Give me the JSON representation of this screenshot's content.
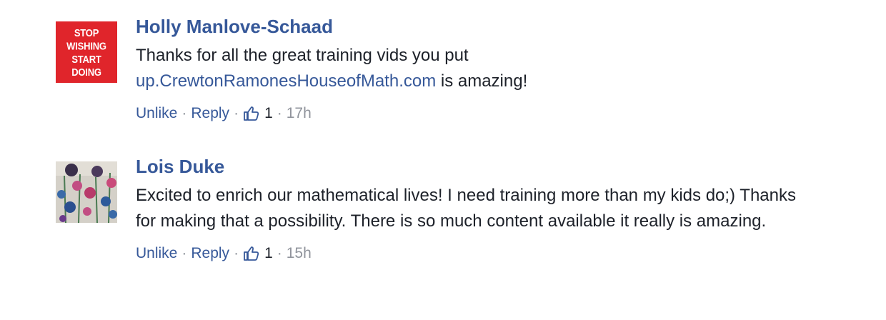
{
  "comments": [
    {
      "author": "Holly Manlove-Schaad",
      "avatar_text_line1": "STOP WISHING",
      "avatar_text_line2": "START DOING",
      "avatar_color": "#e0252b",
      "text_before": "Thanks for all the great training vids you put ",
      "link": "up.CrewtonRamonesHouseofMath.com",
      "text_after": " is amazing!",
      "unlike_label": "Unlike",
      "reply_label": "Reply",
      "like_count": "1",
      "time": "17h"
    },
    {
      "author": "Lois Duke",
      "avatar_icon": "flower-painting-image",
      "text": "Excited to enrich our mathematical lives! I need training more than my kids do;) Thanks for making that a possibility. There is so much content available it really is amazing.",
      "unlike_label": "Unlike",
      "reply_label": "Reply",
      "like_count": "1",
      "time": "15h"
    }
  ],
  "colors": {
    "link_blue": "#365899",
    "meta_gray": "#90949c",
    "text_dark": "#1d2129"
  },
  "icons": {
    "like": "thumbs-up-icon"
  }
}
